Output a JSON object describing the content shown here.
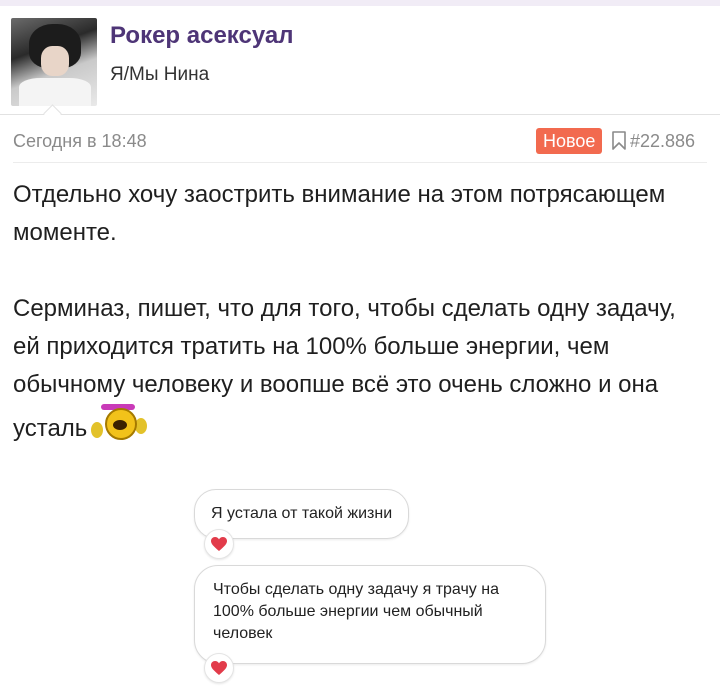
{
  "post": {
    "author": "Рокер асексуал",
    "status": "Я/Мы Нина",
    "date": "Сегодня в 18:48",
    "badge": "Новое",
    "number": "#22.886",
    "paragraph1": "Отдельно хочу заострить внимание на этом потрясающем моменте.",
    "paragraph2": "Серминаз, пишет, что для того, чтобы сделать одну задачу, ей приходится тратить на 100% больше энергии, чем обычному человеку и воопше всё это очень сложно и она усталь",
    "emoji_icon": "crying-face-emoji-icon"
  },
  "messages": [
    {
      "text": "Я устала от такой жизни",
      "reaction": "heart-icon"
    },
    {
      "text": "Чтобы сделать одну задачу я трачу на 100% больше энергии чем обычный человек",
      "reaction": "heart-icon"
    }
  ],
  "colors": {
    "username": "#4e3577",
    "badge": "#f26a4f",
    "heart": "#e23b4a"
  }
}
